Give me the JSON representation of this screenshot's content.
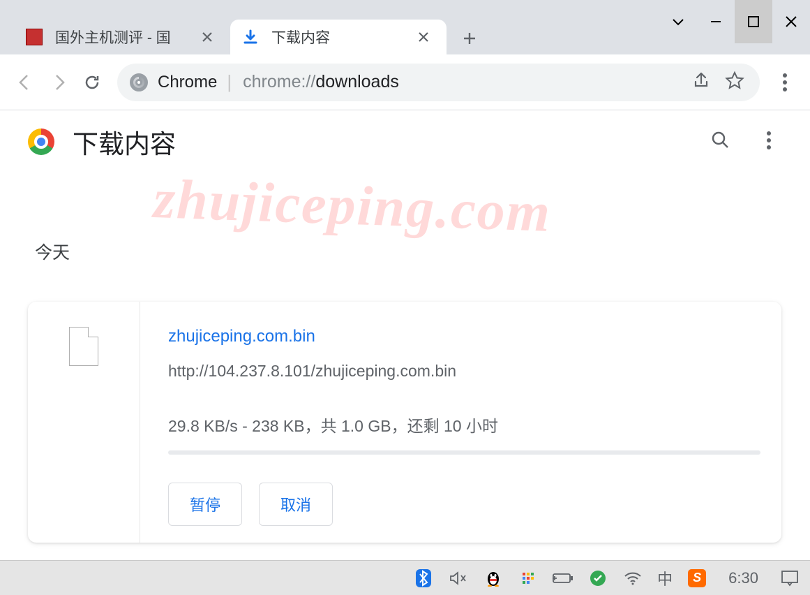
{
  "window": {
    "tabs": [
      {
        "title": "国外主机测评 - 国",
        "favicon": "red-site-icon"
      },
      {
        "title": "下载内容",
        "favicon": "download-icon"
      }
    ],
    "active_tab": 1
  },
  "toolbar": {
    "chip_label": "Chrome",
    "url_gray_prefix": "chrome://",
    "url_dark_part": "downloads"
  },
  "downloads": {
    "page_title": "下载内容",
    "section": "今天",
    "item": {
      "file_name": "zhujiceping.com.bin",
      "source_url": "http://104.237.8.101/zhujiceping.com.bin",
      "status_line": "29.8 KB/s - 238 KB，共 1.0 GB，还剩 10 小时",
      "pause_label": "暂停",
      "cancel_label": "取消"
    }
  },
  "taskbar": {
    "ime": "中",
    "clock": "6:30"
  },
  "watermark": "zhujiceping.com"
}
